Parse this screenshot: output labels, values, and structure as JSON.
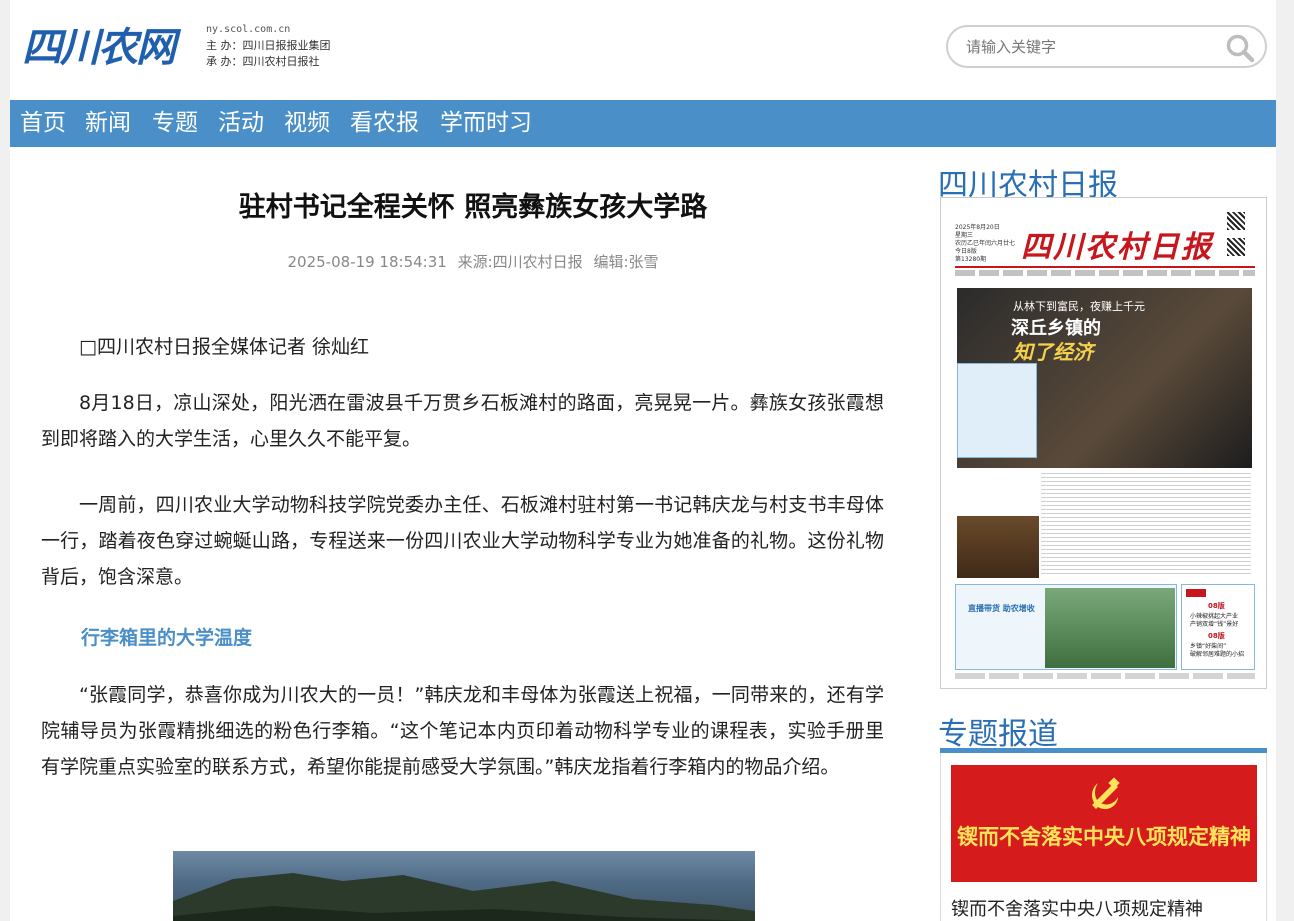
{
  "header": {
    "logo_text": "四川农网",
    "site_url": "ny.scol.com.cn",
    "host_label": "主  办：",
    "host": "四川日报报业集团",
    "organizer_label": "承  办：",
    "organizer": "四川农村日报社"
  },
  "search": {
    "placeholder": "请输入关键字",
    "icon": "search-icon"
  },
  "nav": {
    "items": [
      "首页",
      "新闻",
      "专题",
      "活动",
      "视频",
      "看农报",
      "学而时习"
    ]
  },
  "article": {
    "title": "驻村书记全程关怀 照亮彝族女孩大学路",
    "datetime": "2025-08-19 18:54:31",
    "source_label": "来源:",
    "source": "四川农村日报",
    "editor_label": "编辑:",
    "editor": "张雪",
    "byline": "□四川农村日报全媒体记者 徐灿红",
    "p1": "8月18日，凉山深处，阳光洒在雷波县千万贯乡石板滩村的路面，亮晃晃一片。彝族女孩张霞想到即将踏入的大学生活，心里久久不能平复。",
    "p2": "一周前，四川农业大学动物科技学院党委办主任、石板滩村驻村第一书记韩庆龙与村支书丰母体一行，踏着夜色穿过蜿蜒山路，专程送来一份四川农业大学动物科学专业为她准备的礼物。这份礼物背后，饱含深意。",
    "subhead": "行李箱里的大学温度",
    "p3": "“张霞同学，恭喜你成为川农大的一员！”韩庆龙和丰母体为张霞送上祝福，一同带来的，还有学院辅导员为张霞精挑细选的粉色行李箱。“这个笔记本内页印着动物科学专业的课程表，实验手册里有学院重点实验室的联系方式，希望你能提前感受大学氛围。”韩庆龙指着行李箱内的物品介绍。"
  },
  "sidebar": {
    "paper_heading": "四川农村日报",
    "paper": {
      "masthead": "四川农村日报",
      "date": "2025年8月20日",
      "weekday": "星期三",
      "lunar": "农历乙巳年闰六月廿七",
      "pages": "今日8版",
      "issue": "第13280期",
      "cover_kicker": "从林下到富民，夜赚上千元",
      "cover_headline": "深丘乡镇的",
      "cover_highlight": "知了经济",
      "box_title": "直播带货 助农增收",
      "page_a": "08版",
      "page_a_line1": "小辣椒挑起大产业",
      "page_a_line2": "产销双增“钱”景好",
      "page_b": "08版",
      "page_b_line1": "乡镇“好柴间”",
      "page_b_line2": "破解邻居难题的小招"
    },
    "special_heading": "专题报道",
    "banner_text": "锲而不舍落实中央八项规定精神",
    "banner_caption": "锲而不舍落实中央八项规定精神",
    "colors": {
      "accent": "#4a8fc7",
      "banner_red": "#d51b1b",
      "banner_gold": "#ffe35a"
    }
  }
}
